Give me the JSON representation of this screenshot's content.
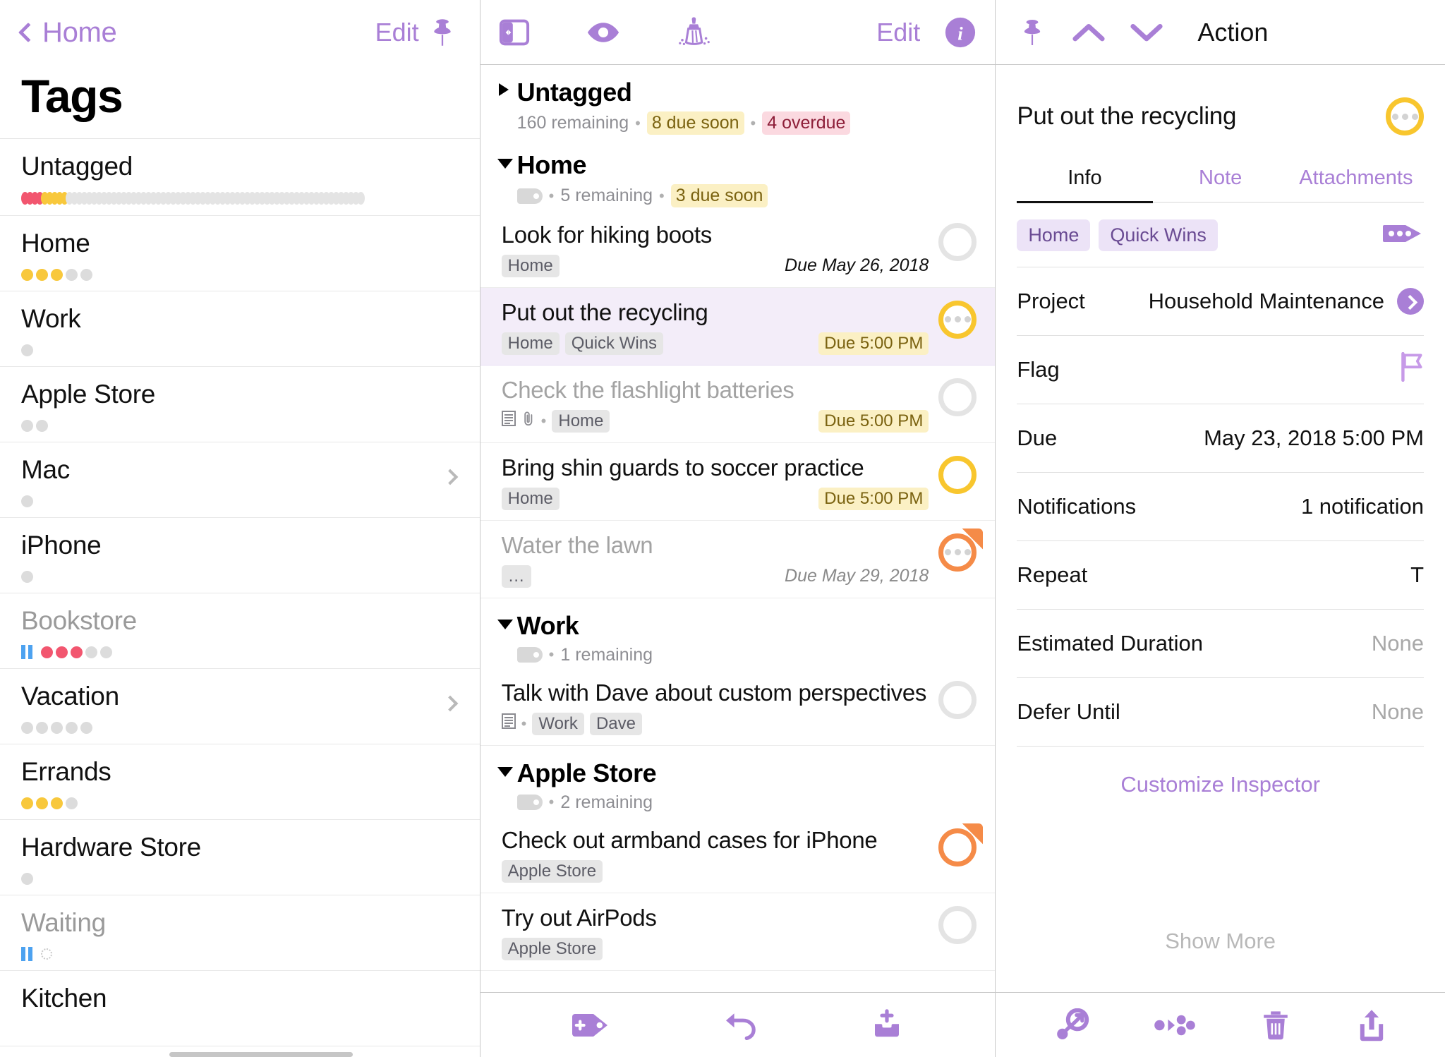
{
  "sidebar": {
    "back_label": "Home",
    "edit_label": "Edit",
    "title": "Tags",
    "pin_icon": "pin-icon",
    "items": [
      {
        "label": "Untagged",
        "dimmed": false,
        "scallop": true,
        "chevron": false,
        "scallop_colors": [
          "#f2566f",
          "#f2566f",
          "#f2566f",
          "#f2566f",
          "#f8c83c",
          "#f8c83c",
          "#f8c83c",
          "#f8c83c",
          "#f8c83c"
        ]
      },
      {
        "label": "Home",
        "dimmed": false,
        "chevron": false,
        "dots": [
          "y",
          "y",
          "y",
          "g",
          "g"
        ]
      },
      {
        "label": "Work",
        "dimmed": false,
        "chevron": false,
        "dots": [
          "g"
        ]
      },
      {
        "label": "Apple Store",
        "dimmed": false,
        "chevron": false,
        "dots": [
          "g",
          "g"
        ]
      },
      {
        "label": "Mac",
        "dimmed": false,
        "chevron": true,
        "dots": [
          "g"
        ]
      },
      {
        "label": "iPhone",
        "dimmed": false,
        "chevron": false,
        "dots": [
          "g"
        ]
      },
      {
        "label": "Bookstore",
        "dimmed": true,
        "chevron": false,
        "paused": true,
        "dots": [
          "r",
          "r",
          "r",
          "g",
          "g"
        ]
      },
      {
        "label": "Vacation",
        "dimmed": false,
        "chevron": true,
        "dots": [
          "g",
          "g",
          "g",
          "g",
          "g"
        ]
      },
      {
        "label": "Errands",
        "dimmed": false,
        "chevron": false,
        "dots": [
          "y",
          "y",
          "y",
          "g"
        ]
      },
      {
        "label": "Hardware Store",
        "dimmed": false,
        "chevron": false,
        "dots": [
          "g"
        ]
      },
      {
        "label": "Waiting",
        "dimmed": true,
        "chevron": false,
        "paused": true,
        "dots": [
          "hollow"
        ]
      },
      {
        "label": "Kitchen",
        "dimmed": false,
        "chevron": false,
        "dots": []
      }
    ]
  },
  "center": {
    "toolbar": {
      "sidebar_toggle_icon": "sidebar-toggle-icon",
      "view_icon": "eye-icon",
      "cleanup_icon": "broom-icon",
      "edit_label": "Edit",
      "info_icon": "info-icon"
    },
    "groups": [
      {
        "title": "Untagged",
        "expanded": false,
        "has_tag_icon": false,
        "remaining": "160 remaining",
        "due_soon": "8 due soon",
        "overdue": "4 overdue",
        "tasks": []
      },
      {
        "title": "Home",
        "expanded": true,
        "has_tag_icon": true,
        "remaining": "5 remaining",
        "due_soon": "3 due soon",
        "overdue": null,
        "tasks": [
          {
            "title": "Look for hiking boots",
            "dim": false,
            "selected": false,
            "tags": [
              "Home"
            ],
            "note": false,
            "attachment": false,
            "due_text": "Due May 26, 2018",
            "due_style": "plain",
            "circle": "gray",
            "dots_in_circle": false,
            "flagged": false
          },
          {
            "title": "Put out the recycling",
            "dim": false,
            "selected": true,
            "tags": [
              "Home",
              "Quick Wins"
            ],
            "note": false,
            "attachment": false,
            "due_text": "Due 5:00 PM",
            "due_style": "chip",
            "circle": "gold",
            "dots_in_circle": true,
            "flagged": false
          },
          {
            "title": "Check the flashlight batteries",
            "dim": true,
            "selected": false,
            "tags": [
              "Home"
            ],
            "note": true,
            "attachment": true,
            "due_text": "Due 5:00 PM",
            "due_style": "chip",
            "circle": "gray",
            "dots_in_circle": false,
            "flagged": false
          },
          {
            "title": "Bring shin guards to soccer practice",
            "dim": false,
            "selected": false,
            "tags": [
              "Home"
            ],
            "note": false,
            "attachment": false,
            "due_text": "Due 5:00 PM",
            "due_style": "chip",
            "circle": "gold",
            "dots_in_circle": false,
            "flagged": false
          },
          {
            "title": "Water the lawn",
            "dim": true,
            "selected": false,
            "tags": [
              "..."
            ],
            "note": false,
            "attachment": false,
            "due_text": "Due May 29, 2018",
            "due_style": "plain-dim",
            "circle": "orange",
            "dots_in_circle": true,
            "flagged": true
          }
        ]
      },
      {
        "title": "Work",
        "expanded": true,
        "has_tag_icon": true,
        "remaining": "1 remaining",
        "due_soon": null,
        "overdue": null,
        "tasks": [
          {
            "title": "Talk with Dave about custom perspectives",
            "dim": false,
            "selected": false,
            "tags": [
              "Work",
              "Dave"
            ],
            "note": true,
            "attachment": false,
            "due_text": null,
            "due_style": null,
            "circle": "gray",
            "dots_in_circle": false,
            "flagged": false
          }
        ]
      },
      {
        "title": "Apple Store",
        "expanded": true,
        "has_tag_icon": true,
        "remaining": "2 remaining",
        "due_soon": null,
        "overdue": null,
        "tasks": [
          {
            "title": "Check out armband cases for iPhone",
            "dim": false,
            "selected": false,
            "tags": [
              "Apple Store"
            ],
            "note": false,
            "attachment": false,
            "due_text": null,
            "due_style": null,
            "circle": "orange",
            "dots_in_circle": false,
            "flagged": true
          },
          {
            "title": "Try out AirPods",
            "dim": false,
            "selected": false,
            "tags": [
              "Apple Store"
            ],
            "note": false,
            "attachment": false,
            "due_text": null,
            "due_style": null,
            "circle": "gray",
            "dots_in_circle": false,
            "flagged": false
          }
        ]
      }
    ],
    "bottom": {
      "add_tag_icon": "add-tag-icon",
      "undo_icon": "undo-icon",
      "inbox_add_icon": "inbox-add-icon"
    }
  },
  "inspector": {
    "toolbar": {
      "pin_icon": "pin-icon",
      "up_icon": "chevron-up-icon",
      "down_icon": "chevron-down-icon",
      "title": "Action"
    },
    "task_title": "Put out the recycling",
    "circle_state": "gold",
    "tabs": [
      {
        "label": "Info",
        "active": true
      },
      {
        "label": "Note",
        "active": false
      },
      {
        "label": "Attachments",
        "active": false
      }
    ],
    "tags": [
      "Home",
      "Quick Wins"
    ],
    "tag_edit_icon": "tag-edit-icon",
    "rows": [
      {
        "label": "Project",
        "value": "Household Maintenance",
        "arrow": true,
        "flag": false,
        "muted": false
      },
      {
        "label": "Flag",
        "value": "",
        "arrow": false,
        "flag": true,
        "muted": false
      },
      {
        "label": "Due",
        "value": "May 23, 2018  5:00 PM",
        "arrow": false,
        "flag": false,
        "muted": false
      },
      {
        "label": "Notifications",
        "value": "1 notification",
        "arrow": false,
        "flag": false,
        "muted": false
      },
      {
        "label": "Repeat",
        "value": "T",
        "arrow": false,
        "flag": false,
        "muted": false
      },
      {
        "label": "Estimated Duration",
        "value": "None",
        "arrow": false,
        "flag": false,
        "muted": true
      },
      {
        "label": "Defer Until",
        "value": "None",
        "arrow": false,
        "flag": false,
        "muted": true
      }
    ],
    "customize_label": "Customize Inspector",
    "show_more_label": "Show More",
    "bottom": {
      "tag_assign_icon": "tag-assign-icon",
      "move_icon": "move-icon",
      "delete_icon": "trash-icon",
      "share_icon": "share-icon"
    }
  },
  "colors": {
    "accent": "#a97fd6",
    "due_soon_bg": "#fbf0c4",
    "due_soon_fg": "#7a6210",
    "overdue_bg": "#fbd9e0",
    "overdue_fg": "#8d1e38",
    "gold": "#f8c62e",
    "orange": "#f58b48",
    "red_dot": "#f2566f",
    "yellow_dot": "#f8c83c",
    "gray_dot": "#dcdcdc",
    "selection_bg": "#f3edf9"
  }
}
